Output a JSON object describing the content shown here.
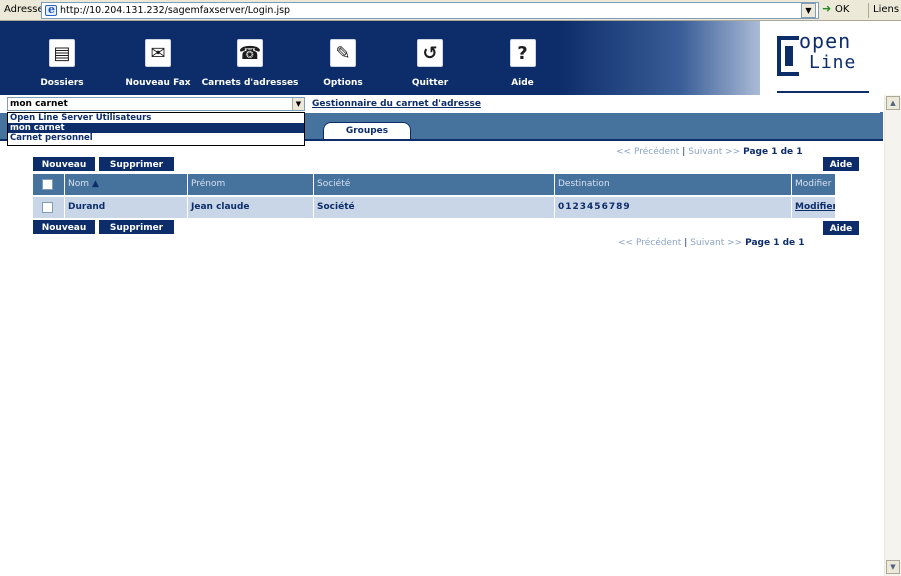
{
  "browser": {
    "address_label": "Adresse",
    "url": "http://10.204.131.232/sagemfaxserver/Login.jsp",
    "go_label": "OK",
    "links_label": "Liens »"
  },
  "toolbar": {
    "items": [
      {
        "label": "Dossiers",
        "icon": "folder-icon"
      },
      {
        "label": "Nouveau Fax",
        "icon": "fax-icon"
      },
      {
        "label": "Carnets d'adresses",
        "icon": "phone-icon"
      },
      {
        "label": "Options",
        "icon": "wrench-icon"
      },
      {
        "label": "Quitter",
        "icon": "exit-icon"
      },
      {
        "label": "Aide",
        "icon": "help-icon"
      }
    ]
  },
  "logo": {
    "line1": "open",
    "line2": "Line"
  },
  "carnet": {
    "selected": "mon carnet",
    "options": [
      "Open Line Server Utilisateurs",
      "mon carnet",
      "Carnet personnel"
    ],
    "gest_link": "Gestionnaire du carnet d'adresse"
  },
  "tabs": {
    "groupes": "Groupes"
  },
  "actions": {
    "nouveau": "Nouveau",
    "supprimer": "Supprimer",
    "aide": "Aide"
  },
  "pager": {
    "precedent": "<< Précédent",
    "suivant": "Suivant >>",
    "page": "Page 1 de 1"
  },
  "table": {
    "columns": [
      "Nom",
      "Prénom",
      "Société",
      "Destination",
      "Modifier"
    ],
    "rows": [
      {
        "nom": "Durand",
        "prenom": "Jean claude",
        "societe": "Société",
        "destination": "0123456789",
        "modifier": "Modifier"
      }
    ]
  },
  "colors": {
    "navy": "#0d2d6a",
    "band": "#46729e",
    "row": "#c9d6e8"
  }
}
